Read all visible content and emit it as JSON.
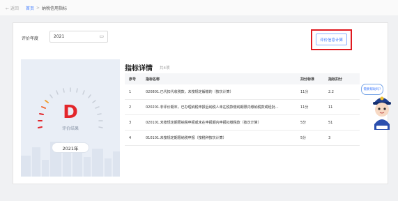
{
  "breadcrumb": {
    "back": "← 返回",
    "home": "首页",
    "sep": ">",
    "current": "纳税信用指标"
  },
  "filter": {
    "label": "评价年度",
    "year": "2021"
  },
  "calc_button": "评价信息计算",
  "red_highlight": "#e0191f",
  "grade": {
    "letter": "D",
    "label": "评价结果",
    "year": "2021年"
  },
  "details": {
    "title": "指标详情",
    "count": "共4项",
    "headers": [
      "序号",
      "指标名称",
      "扣分标准",
      "指标扣分"
    ],
    "rows": [
      [
        "1",
        "020801.已代扣代收税款，未按规定解缴的（按次计算）",
        "11分",
        "2.2"
      ],
      [
        "2",
        "020201.非评价期末，已办理纳税申报后纳税人未在税款缴纳期限内缴纳税款或经批…",
        "11分",
        "11"
      ],
      [
        "3",
        "020101.未按规定期限纳税申报或未在申报期内申报扣缴税款（按次计算）",
        "5分",
        "51"
      ],
      [
        "4",
        "010101.未按规定期限纳税申报（按税种按次计算）",
        "5分",
        "3"
      ]
    ]
  },
  "assistant": {
    "bubble": "需要帮助吗?"
  }
}
